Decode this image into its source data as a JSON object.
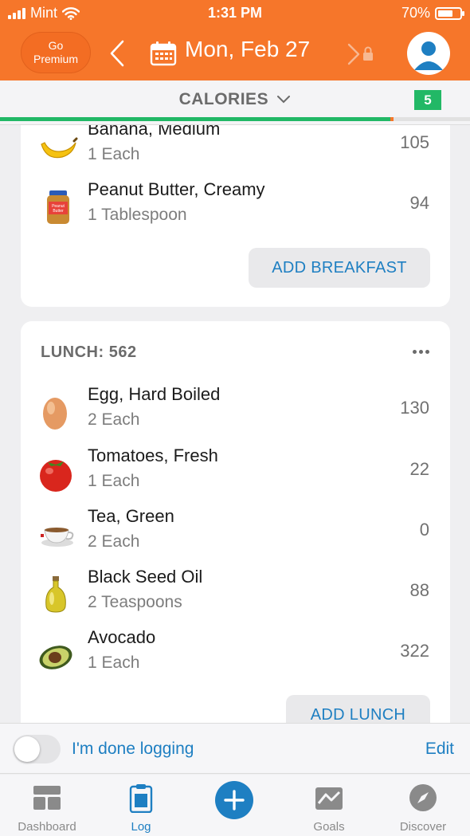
{
  "status_bar": {
    "carrier": "Mint",
    "time": "1:31 PM",
    "battery": "70%",
    "battery_level": 0.7
  },
  "header": {
    "premium_line1": "Go",
    "premium_line2": "Premium",
    "date": "Mon, Feb 27"
  },
  "calories_bar": {
    "title": "CALORIES",
    "badge": "5",
    "progress": 0.83
  },
  "breakfast": {
    "items": [
      {
        "name": "Banana, Medium",
        "qty": "1 Each",
        "cal": "105",
        "icon": "banana-icon"
      },
      {
        "name": "Peanut Butter, Creamy",
        "qty": "1 Tablespoon",
        "cal": "94",
        "icon": "peanut-butter-icon"
      }
    ],
    "add_label": "ADD BREAKFAST"
  },
  "lunch": {
    "title": "LUNCH: 562",
    "items": [
      {
        "name": "Egg, Hard Boiled",
        "qty": "2 Each",
        "cal": "130",
        "icon": "egg-icon"
      },
      {
        "name": "Tomatoes, Fresh",
        "qty": "1 Each",
        "cal": "22",
        "icon": "tomato-icon"
      },
      {
        "name": "Tea, Green",
        "qty": "2 Each",
        "cal": "0",
        "icon": "tea-cup-icon"
      },
      {
        "name": "Black Seed Oil",
        "qty": "2 Teaspoons",
        "cal": "88",
        "icon": "oil-bottle-icon"
      },
      {
        "name": "Avocado",
        "qty": "1 Each",
        "cal": "322",
        "icon": "avocado-icon"
      }
    ],
    "add_label": "ADD LUNCH"
  },
  "done_bar": {
    "label": "I'm done logging",
    "edit": "Edit"
  },
  "tabs": [
    {
      "label": "Dashboard",
      "icon": "dashboard-icon"
    },
    {
      "label": "Log",
      "icon": "log-clipboard-icon"
    },
    {
      "label": "",
      "icon": "plus-icon"
    },
    {
      "label": "Goals",
      "icon": "goals-icon"
    },
    {
      "label": "Discover",
      "icon": "compass-icon"
    }
  ],
  "colors": {
    "brand_orange": "#f6762a",
    "accent_blue": "#1e7fc2",
    "green": "#22b866"
  }
}
